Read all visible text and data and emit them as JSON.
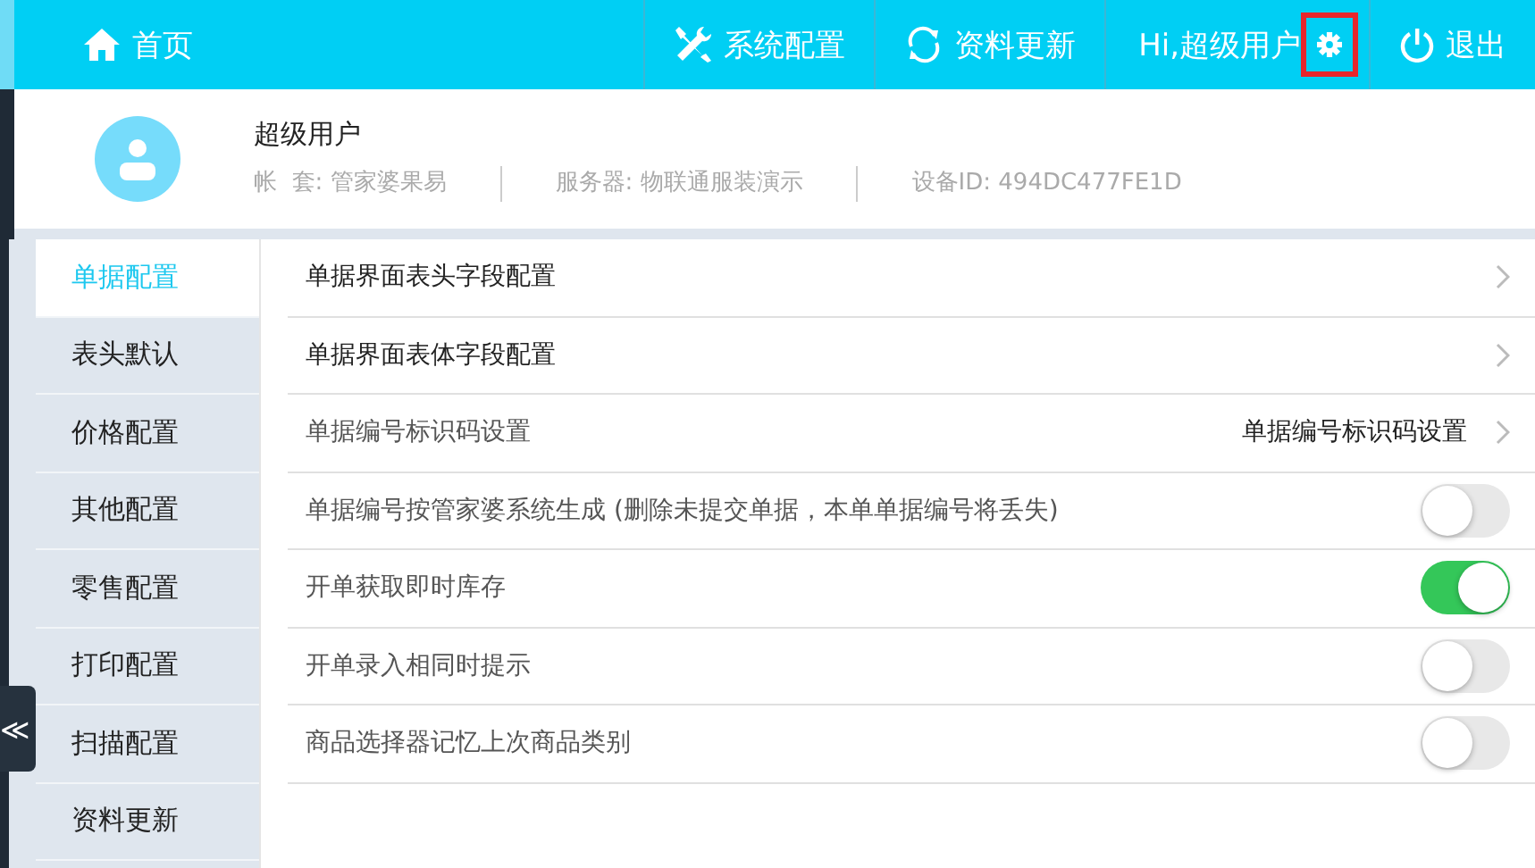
{
  "top_bar": {
    "home": "首页",
    "buttons": [
      {
        "kind": "tools",
        "label": "系统配置"
      },
      {
        "kind": "sync",
        "label": "资料更新"
      }
    ],
    "greeting": "Hi,超级用户",
    "settings_highlighted": true,
    "logout": "退出"
  },
  "profile": {
    "name": "超级用户",
    "fields": [
      {
        "label": "帐  套:",
        "value": "管家婆果易"
      },
      {
        "label": "服务器:",
        "value": "物联通服装演示"
      },
      {
        "label": "设备ID:",
        "value": "494DC477FE1D"
      }
    ]
  },
  "sidebar": {
    "items": [
      {
        "label": "单据配置",
        "selected": true
      },
      {
        "label": "表头默认",
        "selected": false
      },
      {
        "label": "价格配置",
        "selected": false
      },
      {
        "label": "其他配置",
        "selected": false
      },
      {
        "label": "零售配置",
        "selected": false
      },
      {
        "label": "打印配置",
        "selected": false
      },
      {
        "label": "扫描配置",
        "selected": false
      },
      {
        "label": "资料更新",
        "selected": false
      }
    ],
    "collapse": "≪"
  },
  "settings": [
    {
      "kind": "link",
      "label": "单据界面表头字段配置"
    },
    {
      "kind": "link",
      "label": "单据界面表体字段配置"
    },
    {
      "kind": "value",
      "label": "单据编号标识码设置",
      "value": "单据编号标识码设置"
    },
    {
      "kind": "toggle",
      "label": "单据编号按管家婆系统生成 (删除未提交单据，本单单据编号将丢失)",
      "on": false
    },
    {
      "kind": "toggle",
      "label": "开单获取即时库存",
      "on": true
    },
    {
      "kind": "toggle",
      "label": "开单录入相同时提示",
      "on": false
    },
    {
      "kind": "toggle",
      "label": "商品选择器记忆上次商品类别",
      "on": false
    }
  ]
}
